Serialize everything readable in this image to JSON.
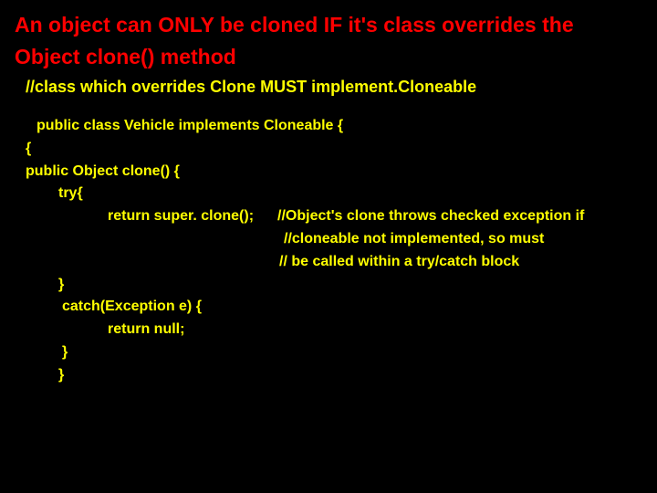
{
  "title": "An object can ONLY be cloned IF it's class overrides the Object clone() method",
  "subtitle": "//class which overrides Clone MUST implement.Cloneable",
  "code": {
    "decl": "public class Vehicle implements Cloneable {",
    "brace": "{",
    "sig": "public Object clone() {",
    "tryOpen": "try{",
    "ret": "return super. clone();",
    "cmt1": "//Object's clone throws checked exception if",
    "cmt2": "//cloneable not implemented, so must",
    "cmt3": "// be called within a try/catch block",
    "closeTry": "}",
    "catchOpen": "catch(Exception e) {",
    "retNull": "return null;",
    "closeCatch": "}",
    "closeMethod": "}"
  }
}
